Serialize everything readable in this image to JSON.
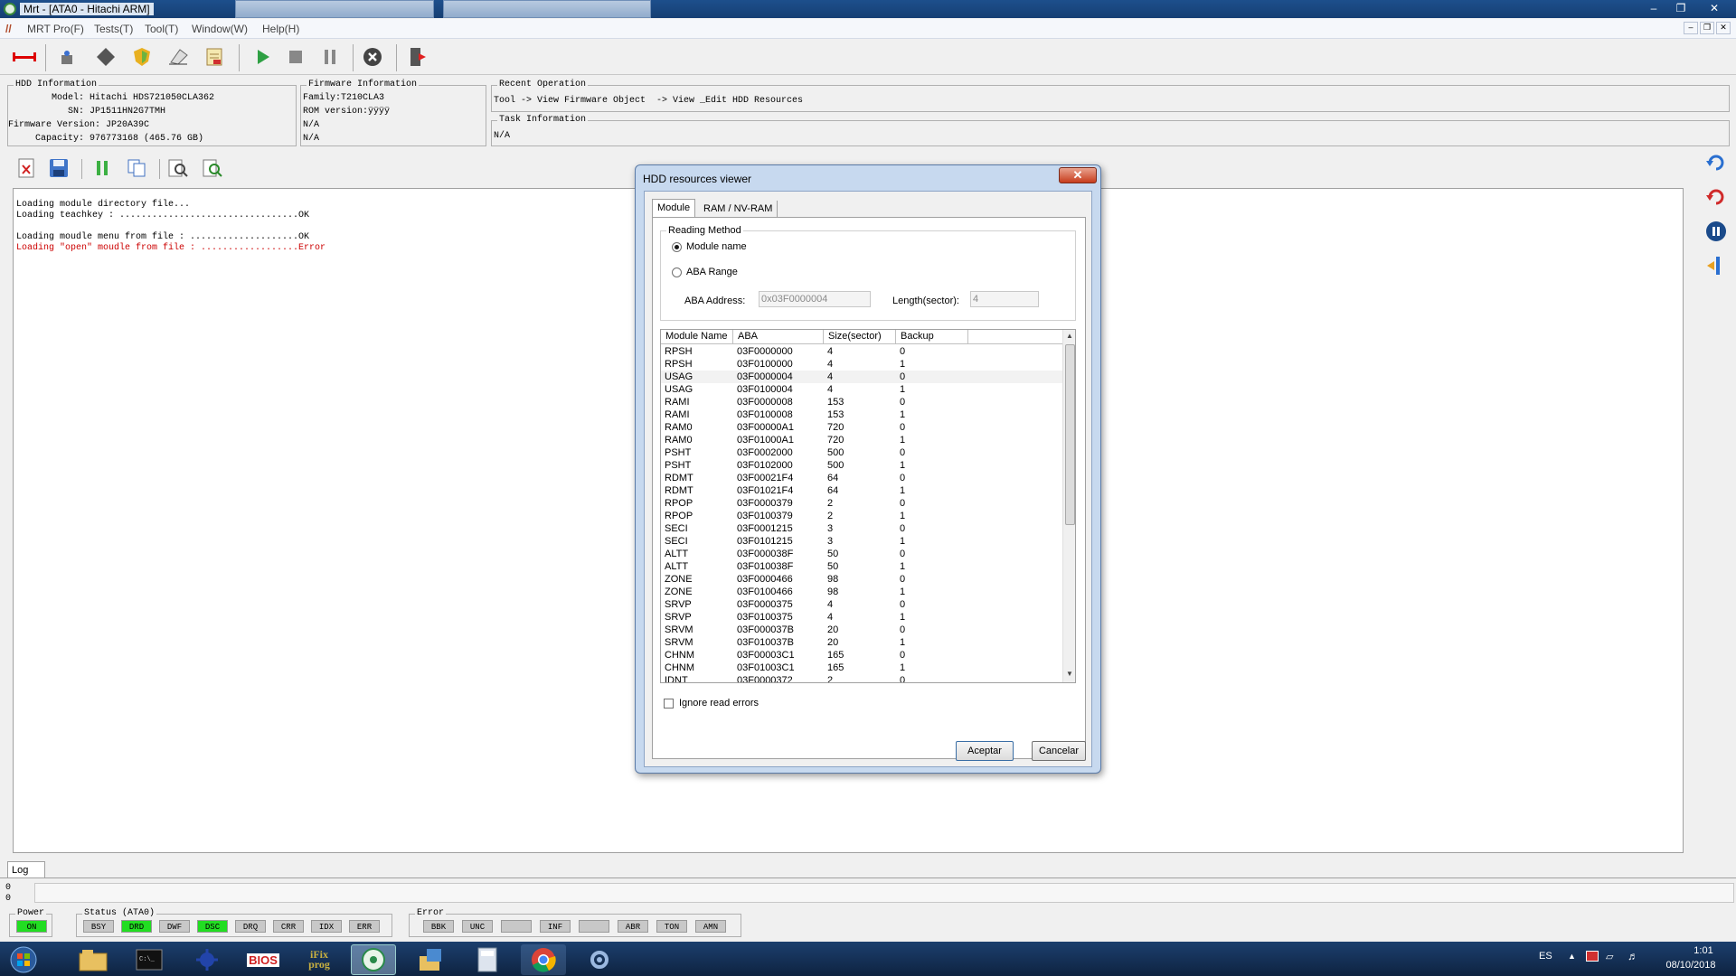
{
  "window": {
    "title": "Mrt - [ATA0 - Hitachi ARM]"
  },
  "menu": [
    "MRT Pro(F)",
    "Tests(T)",
    "Tool(T)",
    "Window(W)",
    "Help(H)"
  ],
  "hdd_info": {
    "title": "HDD Information",
    "lines": [
      "        Model: Hitachi HDS721050CLA362",
      "           SN: JP1511HN2G7TMH",
      "Firmware Version: JP20A39C",
      "     Capacity: 976773168 (465.76 GB)"
    ]
  },
  "firmware_info": {
    "title": "Firmware Information",
    "lines": [
      "Family:T210CLA3",
      "ROM version:ÿÿÿÿ",
      "N/A",
      "N/A"
    ]
  },
  "recent_operation": {
    "title": "Recent Operation",
    "text": "Tool -> View Firmware Object  -> View _Edit HDD Resources"
  },
  "task_information": {
    "title": "Task Information",
    "text": "N/A"
  },
  "log": {
    "lines": [
      {
        "text": "Loading module directory file...",
        "color": "#000000"
      },
      {
        "text": "Loading teachkey : .................................OK",
        "color": "#000000"
      },
      {
        "text": "",
        "color": "#000000"
      },
      {
        "text": "Loading moudle menu from file : ....................OK",
        "color": "#000000"
      },
      {
        "text": "Loading \"open\" moudle from file : ..................Error",
        "color": "#cc0000"
      }
    ],
    "tab_label": "Log",
    "bottom_values": [
      "0",
      "0"
    ]
  },
  "dialog": {
    "title": "HDD resources viewer",
    "tabs": [
      "Module",
      "RAM / NV-RAM"
    ],
    "reading_method": {
      "title": "Reading Method",
      "option_module_name": "Module name",
      "option_aba_range": "ABA Range",
      "selected": "Module name",
      "aba_address_label": "ABA Address:",
      "aba_address_value": "0x03F0000004",
      "length_label": "Length(sector):",
      "length_value": "4"
    },
    "columns": [
      "Module Name",
      "ABA",
      "Size(sector)",
      "Backup"
    ],
    "rows": [
      [
        "RPSH",
        "03F0000000",
        "4",
        "0"
      ],
      [
        "RPSH",
        "03F0100000",
        "4",
        "1"
      ],
      [
        "USAG",
        "03F0000004",
        "4",
        "0"
      ],
      [
        "USAG",
        "03F0100004",
        "4",
        "1"
      ],
      [
        "RAMI",
        "03F0000008",
        "153",
        "0"
      ],
      [
        "RAMI",
        "03F0100008",
        "153",
        "1"
      ],
      [
        "RAM0",
        "03F00000A1",
        "720",
        "0"
      ],
      [
        "RAM0",
        "03F01000A1",
        "720",
        "1"
      ],
      [
        "PSHT",
        "03F0002000",
        "500",
        "0"
      ],
      [
        "PSHT",
        "03F0102000",
        "500",
        "1"
      ],
      [
        "RDMT",
        "03F00021F4",
        "64",
        "0"
      ],
      [
        "RDMT",
        "03F01021F4",
        "64",
        "1"
      ],
      [
        "RPOP",
        "03F0000379",
        "2",
        "0"
      ],
      [
        "RPOP",
        "03F0100379",
        "2",
        "1"
      ],
      [
        "SECI",
        "03F0001215",
        "3",
        "0"
      ],
      [
        "SECI",
        "03F0101215",
        "3",
        "1"
      ],
      [
        "ALTT",
        "03F000038F",
        "50",
        "0"
      ],
      [
        "ALTT",
        "03F010038F",
        "50",
        "1"
      ],
      [
        "ZONE",
        "03F0000466",
        "98",
        "0"
      ],
      [
        "ZONE",
        "03F0100466",
        "98",
        "1"
      ],
      [
        "SRVP",
        "03F0000375",
        "4",
        "0"
      ],
      [
        "SRVP",
        "03F0100375",
        "4",
        "1"
      ],
      [
        "SRVM",
        "03F000037B",
        "20",
        "0"
      ],
      [
        "SRVM",
        "03F010037B",
        "20",
        "1"
      ],
      [
        "CHNM",
        "03F00003C1",
        "165",
        "0"
      ],
      [
        "CHNM",
        "03F01003C1",
        "165",
        "1"
      ],
      [
        "IDNT",
        "03F0000372",
        "2",
        "0"
      ]
    ],
    "ignore_read_errors": "Ignore read errors",
    "ok_label": "Aceptar",
    "cancel_label": "Cancelar"
  },
  "status": {
    "power_title": "Power",
    "power_lamp": "ON",
    "status_title": "Status (ATA0)",
    "status_lamps": [
      {
        "label": "BSY",
        "on": false
      },
      {
        "label": "DRD",
        "on": true
      },
      {
        "label": "DWF",
        "on": false
      },
      {
        "label": "DSC",
        "on": true
      },
      {
        "label": "DRQ",
        "on": false
      },
      {
        "label": "CRR",
        "on": false
      },
      {
        "label": "IDX",
        "on": false
      },
      {
        "label": "ERR",
        "on": false
      }
    ],
    "error_title": "Error",
    "error_lamps": [
      "BBK",
      "UNC",
      "",
      "INF",
      "",
      "ABR",
      "TON",
      "AMN"
    ]
  },
  "taskbar": {
    "language": "ES",
    "time": "1:01",
    "date": "08/10/2018",
    "apps": [
      "explorer-icon",
      "cmd-icon",
      "tool-icon",
      "bios-icon",
      "ifix-prog-icon",
      "mrt-icon",
      "files-icon",
      "calculator-icon",
      "chrome-icon",
      "settings-icon"
    ],
    "app_labels": {
      "bios": "BIOS",
      "ifix": "iFix\nprog"
    }
  },
  "colors": {
    "lamp_on": "#22dd22",
    "error_text": "#cc0000",
    "title_bar": "#1d4f8c"
  }
}
